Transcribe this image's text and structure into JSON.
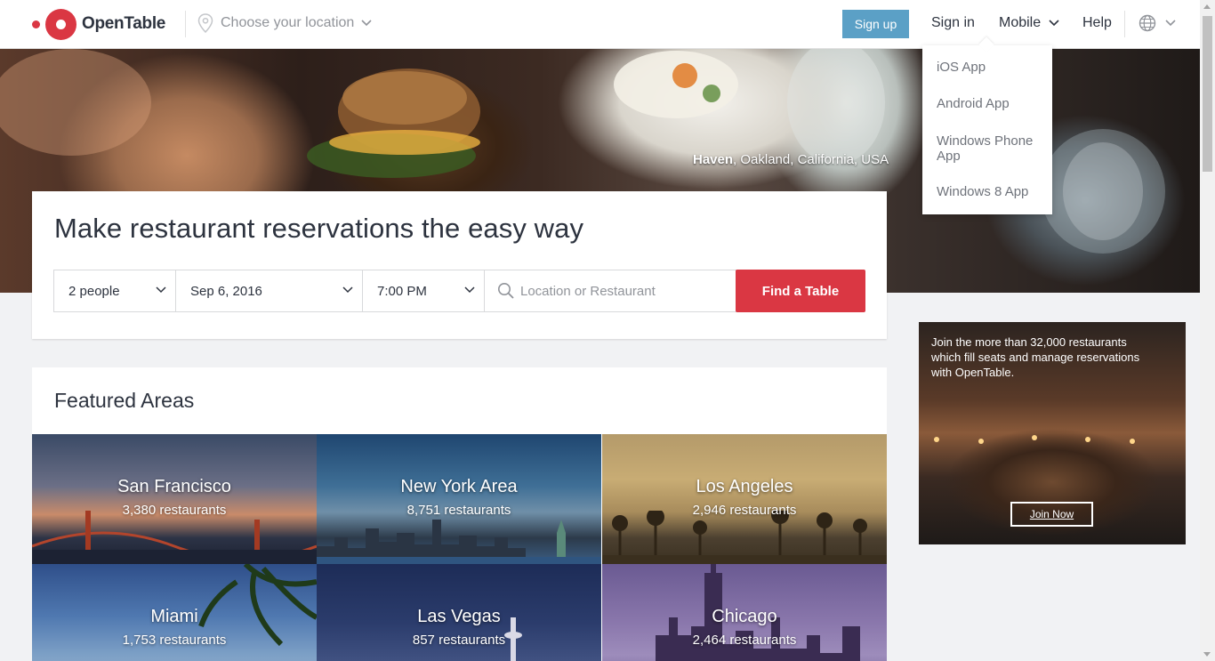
{
  "header": {
    "brand": "OpenTable",
    "location_placeholder": "Choose your location",
    "signup_label": "Sign up",
    "signin_label": "Sign in",
    "mobile_label": "Mobile",
    "help_label": "Help",
    "icons": [
      "map-pin-icon",
      "chevron-down-icon",
      "globe-icon"
    ]
  },
  "hero": {
    "caption_bold": "Haven",
    "caption_rest": ", Oakland, California, USA"
  },
  "search": {
    "title": "Make restaurant reservations the easy way",
    "party_size": "2 people",
    "date": "Sep 6, 2016",
    "time": "7:00 PM",
    "location_placeholder": "Location or Restaurant",
    "find_label": "Find a Table"
  },
  "featured": {
    "title": "Featured Areas",
    "areas": [
      {
        "name": "San Francisco",
        "count": "3,380 restaurants"
      },
      {
        "name": "New York Area",
        "count": "8,751 restaurants"
      },
      {
        "name": "Los Angeles",
        "count": "2,946 restaurants"
      },
      {
        "name": "Miami",
        "count": "1,753 restaurants"
      },
      {
        "name": "Las Vegas",
        "count": "857 restaurants"
      },
      {
        "name": "Chicago",
        "count": "2,464 restaurants"
      }
    ]
  },
  "promo": {
    "text": "Join the more than 32,000 restaurants which fill seats and manage reservations with OpenTable.",
    "button_label": "Join Now"
  },
  "mobile_menu": {
    "items": [
      "iOS App",
      "Android App",
      "Windows Phone App",
      "Windows 8 App"
    ]
  },
  "colors": {
    "brand_red": "#da3743",
    "signup_blue": "#5ba0c6",
    "text_dark": "#2d333f",
    "page_bg": "#f1f2f4"
  }
}
